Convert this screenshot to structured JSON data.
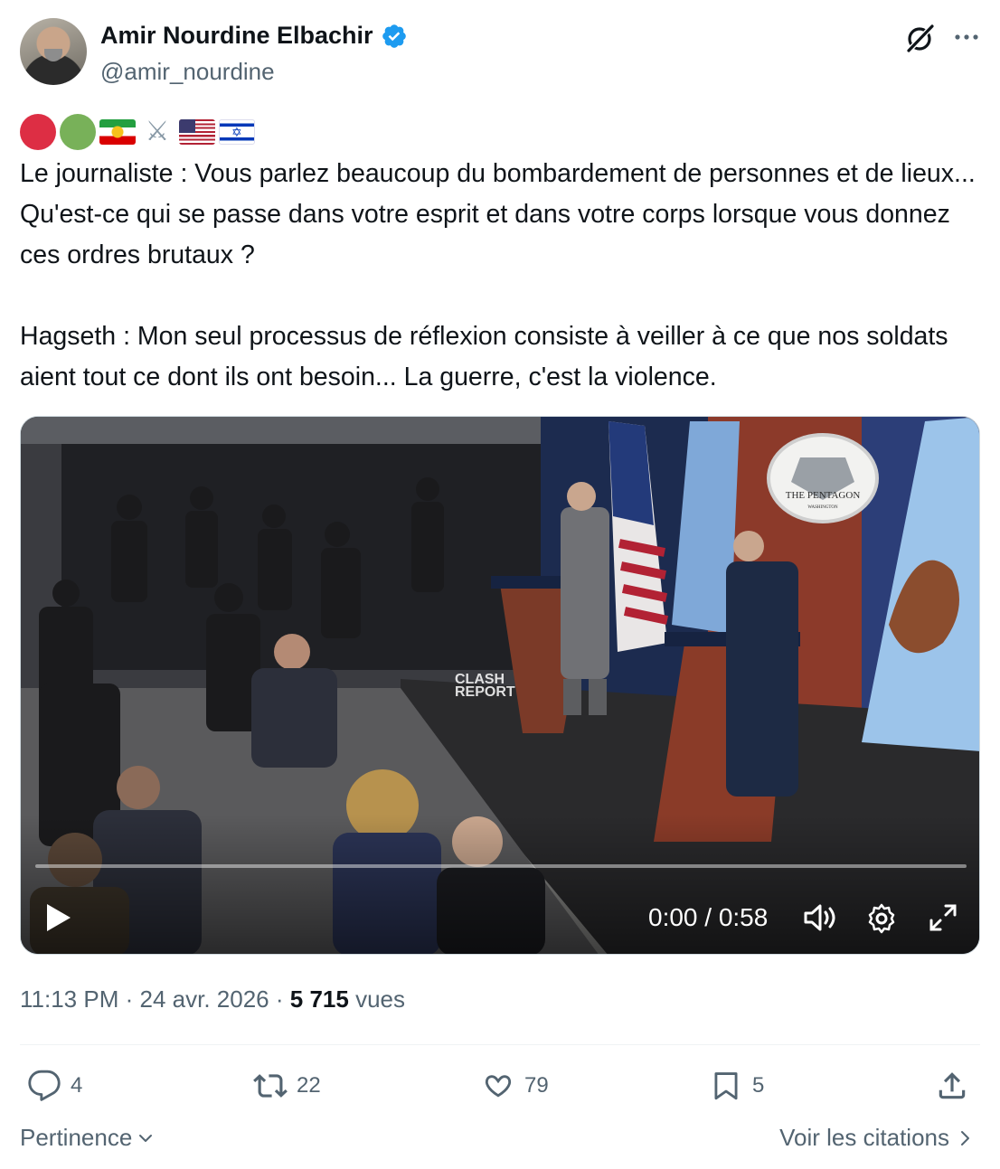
{
  "author": {
    "display_name": "Amir Nourdine Elbachir",
    "handle": "@amir_nourdine",
    "verified": true
  },
  "header_icons": [
    "grok-icon",
    "more-icon"
  ],
  "emoji_line": [
    "red-circle",
    "green-circle",
    "iran-flag",
    "crossed-swords",
    "usa-flag",
    "israel-flag"
  ],
  "tweet": {
    "paragraph1": "Le journaliste : Vous parlez beaucoup du bombardement de personnes et de lieux... Qu'est-ce qui se passe dans votre esprit et dans votre corps lorsque vous donnez ces ordres brutaux ?",
    "paragraph2": "Hagseth : Mon seul processus de réflexion consiste à veiller à ce que nos soldats aient tout ce dont ils ont besoin... La guerre, c'est la violence."
  },
  "video": {
    "time": "0:00 / 0:58",
    "progress": 0,
    "watermark_line1": "CLASH",
    "watermark_line2": "REPORT",
    "seal_text": "THE PENTAGON",
    "seal_subtext": "WASHINGTON"
  },
  "meta": {
    "time": "11:13 PM",
    "date": "24 avr. 2026",
    "views_count": "5 715",
    "views_label": "vues",
    "separator": "·"
  },
  "actions": {
    "replies": "4",
    "reposts": "22",
    "likes": "79",
    "bookmarks": "5"
  },
  "footer": {
    "sort_label": "Pertinence",
    "quotes_label": "Voir les citations"
  },
  "colors": {
    "text": "#0f1419",
    "secondary": "#536471",
    "verified_blue": "#1d9bf0"
  }
}
